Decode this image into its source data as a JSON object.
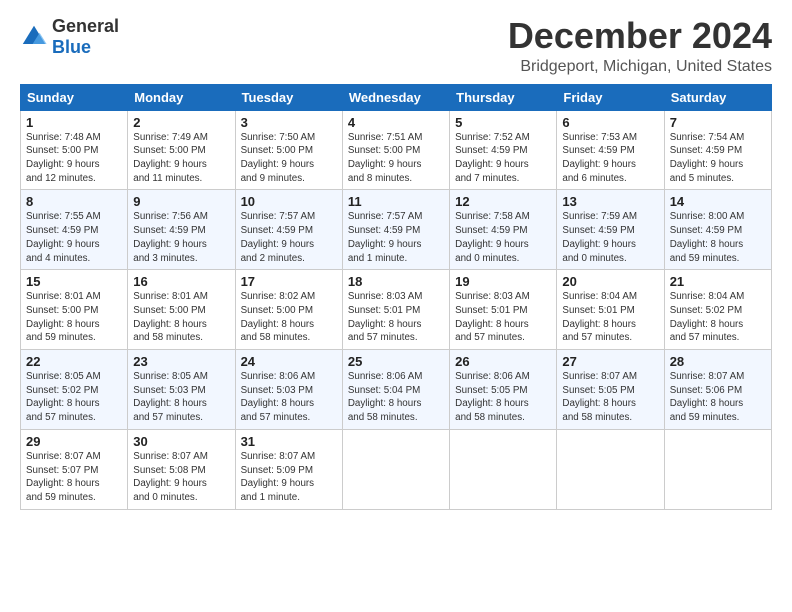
{
  "header": {
    "logo_general": "General",
    "logo_blue": "Blue",
    "title": "December 2024",
    "subtitle": "Bridgeport, Michigan, United States"
  },
  "calendar": {
    "days_of_week": [
      "Sunday",
      "Monday",
      "Tuesday",
      "Wednesday",
      "Thursday",
      "Friday",
      "Saturday"
    ],
    "weeks": [
      [
        {
          "day": "1",
          "info": "Sunrise: 7:48 AM\nSunset: 5:00 PM\nDaylight: 9 hours\nand 12 minutes."
        },
        {
          "day": "2",
          "info": "Sunrise: 7:49 AM\nSunset: 5:00 PM\nDaylight: 9 hours\nand 11 minutes."
        },
        {
          "day": "3",
          "info": "Sunrise: 7:50 AM\nSunset: 5:00 PM\nDaylight: 9 hours\nand 9 minutes."
        },
        {
          "day": "4",
          "info": "Sunrise: 7:51 AM\nSunset: 5:00 PM\nDaylight: 9 hours\nand 8 minutes."
        },
        {
          "day": "5",
          "info": "Sunrise: 7:52 AM\nSunset: 4:59 PM\nDaylight: 9 hours\nand 7 minutes."
        },
        {
          "day": "6",
          "info": "Sunrise: 7:53 AM\nSunset: 4:59 PM\nDaylight: 9 hours\nand 6 minutes."
        },
        {
          "day": "7",
          "info": "Sunrise: 7:54 AM\nSunset: 4:59 PM\nDaylight: 9 hours\nand 5 minutes."
        }
      ],
      [
        {
          "day": "8",
          "info": "Sunrise: 7:55 AM\nSunset: 4:59 PM\nDaylight: 9 hours\nand 4 minutes."
        },
        {
          "day": "9",
          "info": "Sunrise: 7:56 AM\nSunset: 4:59 PM\nDaylight: 9 hours\nand 3 minutes."
        },
        {
          "day": "10",
          "info": "Sunrise: 7:57 AM\nSunset: 4:59 PM\nDaylight: 9 hours\nand 2 minutes."
        },
        {
          "day": "11",
          "info": "Sunrise: 7:57 AM\nSunset: 4:59 PM\nDaylight: 9 hours\nand 1 minute."
        },
        {
          "day": "12",
          "info": "Sunrise: 7:58 AM\nSunset: 4:59 PM\nDaylight: 9 hours\nand 0 minutes."
        },
        {
          "day": "13",
          "info": "Sunrise: 7:59 AM\nSunset: 4:59 PM\nDaylight: 9 hours\nand 0 minutes."
        },
        {
          "day": "14",
          "info": "Sunrise: 8:00 AM\nSunset: 4:59 PM\nDaylight: 8 hours\nand 59 minutes."
        }
      ],
      [
        {
          "day": "15",
          "info": "Sunrise: 8:01 AM\nSunset: 5:00 PM\nDaylight: 8 hours\nand 59 minutes."
        },
        {
          "day": "16",
          "info": "Sunrise: 8:01 AM\nSunset: 5:00 PM\nDaylight: 8 hours\nand 58 minutes."
        },
        {
          "day": "17",
          "info": "Sunrise: 8:02 AM\nSunset: 5:00 PM\nDaylight: 8 hours\nand 58 minutes."
        },
        {
          "day": "18",
          "info": "Sunrise: 8:03 AM\nSunset: 5:01 PM\nDaylight: 8 hours\nand 57 minutes."
        },
        {
          "day": "19",
          "info": "Sunrise: 8:03 AM\nSunset: 5:01 PM\nDaylight: 8 hours\nand 57 minutes."
        },
        {
          "day": "20",
          "info": "Sunrise: 8:04 AM\nSunset: 5:01 PM\nDaylight: 8 hours\nand 57 minutes."
        },
        {
          "day": "21",
          "info": "Sunrise: 8:04 AM\nSunset: 5:02 PM\nDaylight: 8 hours\nand 57 minutes."
        }
      ],
      [
        {
          "day": "22",
          "info": "Sunrise: 8:05 AM\nSunset: 5:02 PM\nDaylight: 8 hours\nand 57 minutes."
        },
        {
          "day": "23",
          "info": "Sunrise: 8:05 AM\nSunset: 5:03 PM\nDaylight: 8 hours\nand 57 minutes."
        },
        {
          "day": "24",
          "info": "Sunrise: 8:06 AM\nSunset: 5:03 PM\nDaylight: 8 hours\nand 57 minutes."
        },
        {
          "day": "25",
          "info": "Sunrise: 8:06 AM\nSunset: 5:04 PM\nDaylight: 8 hours\nand 58 minutes."
        },
        {
          "day": "26",
          "info": "Sunrise: 8:06 AM\nSunset: 5:05 PM\nDaylight: 8 hours\nand 58 minutes."
        },
        {
          "day": "27",
          "info": "Sunrise: 8:07 AM\nSunset: 5:05 PM\nDaylight: 8 hours\nand 58 minutes."
        },
        {
          "day": "28",
          "info": "Sunrise: 8:07 AM\nSunset: 5:06 PM\nDaylight: 8 hours\nand 59 minutes."
        }
      ],
      [
        {
          "day": "29",
          "info": "Sunrise: 8:07 AM\nSunset: 5:07 PM\nDaylight: 8 hours\nand 59 minutes."
        },
        {
          "day": "30",
          "info": "Sunrise: 8:07 AM\nSunset: 5:08 PM\nDaylight: 9 hours\nand 0 minutes."
        },
        {
          "day": "31",
          "info": "Sunrise: 8:07 AM\nSunset: 5:09 PM\nDaylight: 9 hours\nand 1 minute."
        },
        {
          "day": "",
          "info": ""
        },
        {
          "day": "",
          "info": ""
        },
        {
          "day": "",
          "info": ""
        },
        {
          "day": "",
          "info": ""
        }
      ]
    ]
  }
}
